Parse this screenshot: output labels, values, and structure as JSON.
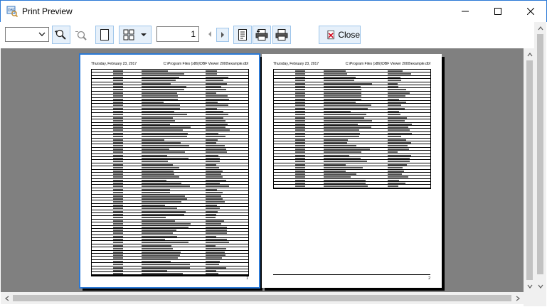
{
  "window": {
    "title": "Print Preview",
    "accent_color": "#2b79d6"
  },
  "toolbar": {
    "zoom_value": "",
    "page_number": "1",
    "close_label": "Close",
    "icons": [
      "zoom-in-icon",
      "zoom-out-icon",
      "single-page-icon",
      "multi-page-icon",
      "prev-page-icon",
      "next-page-icon",
      "page-setup-icon",
      "print-icon",
      "quick-print-icon",
      "close-icon"
    ]
  },
  "pages": [
    {
      "header_left": "Thursday, February 23, 2017",
      "header_right": "C:\\Program Files (x86)\\DBF Viewer 2000\\example.dbf",
      "page_number": "1",
      "rows": 66
    },
    {
      "header_left": "Thursday, February 23, 2017",
      "header_right": "C:\\Program Files (x86)\\DBF Viewer 2000\\example.dbf",
      "page_number": "2",
      "rows": 38
    }
  ]
}
